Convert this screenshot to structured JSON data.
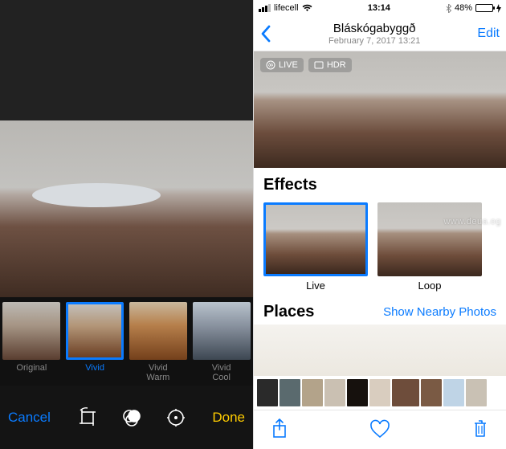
{
  "editor": {
    "cancel": "Cancel",
    "done": "Done",
    "filters": {
      "original": "Original",
      "vivid": "Vivid",
      "vivid_warm": "Vivid\nWarm",
      "vivid_cool": "Vivid\nCool",
      "selected": "vivid"
    },
    "tools": {
      "crop": "crop-rotate",
      "filters_icon": "filters",
      "adjust": "adjust"
    }
  },
  "detail": {
    "status": {
      "carrier": "lifecell",
      "network": "wifi",
      "time": "13:14",
      "battery_pct": "48%",
      "charging": true
    },
    "nav": {
      "back": "Back",
      "title": "Bláskógabyggð",
      "subtitle": "February 7, 2017  13:21",
      "edit": "Edit"
    },
    "badges": {
      "live": "LIVE",
      "hdr": "HDR"
    },
    "sections": {
      "effects": "Effects",
      "places": "Places",
      "show_nearby": "Show Nearby Photos"
    },
    "effects": {
      "live": "Live",
      "loop": "Loop",
      "selected": "live"
    },
    "bottom": {
      "share": "share",
      "like": "heart",
      "trash": "trash"
    }
  },
  "watermark": "www.deua.og"
}
